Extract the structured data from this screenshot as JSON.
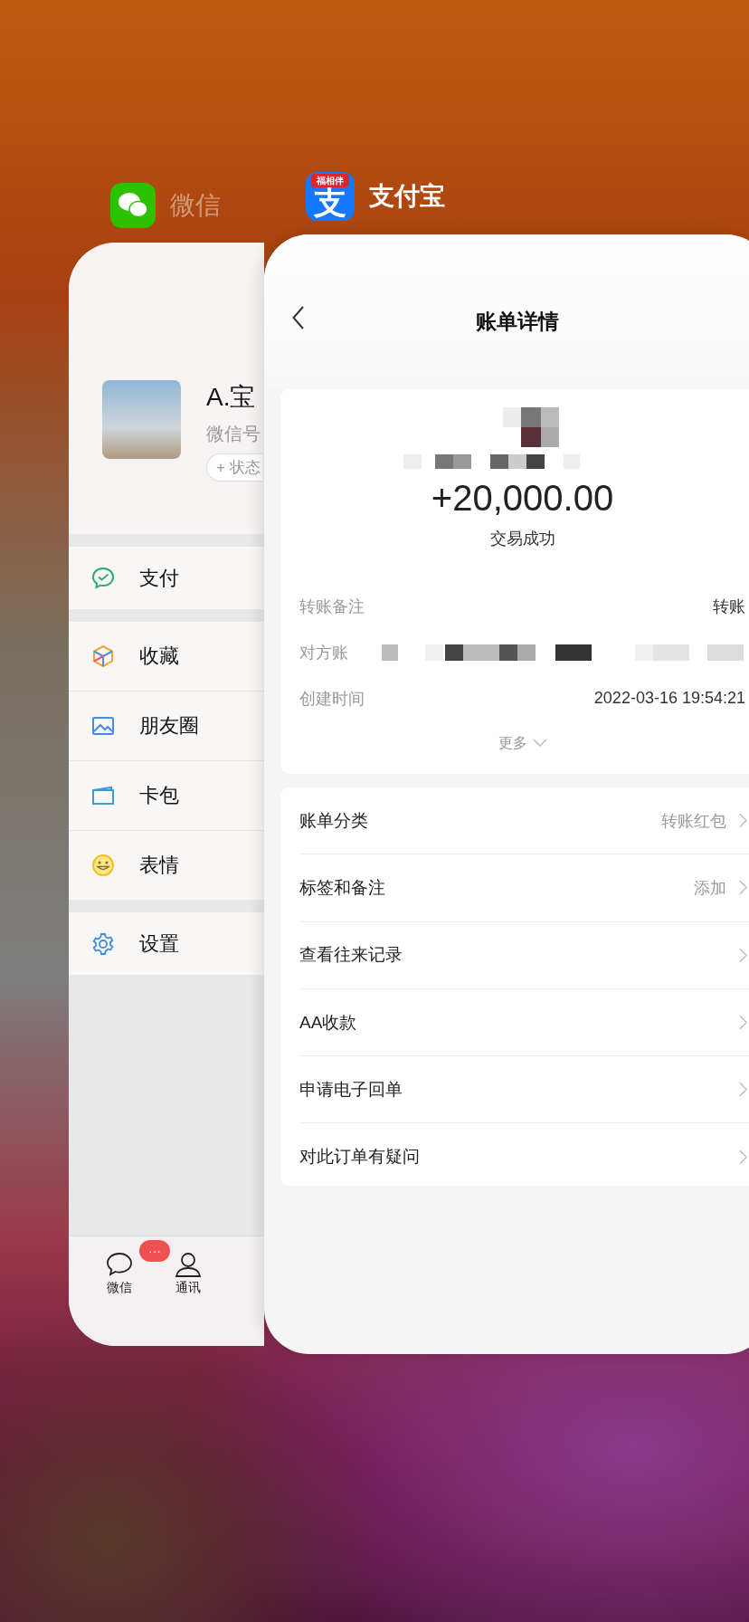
{
  "app_labels": [
    {
      "name": "微信"
    },
    {
      "name": "支付宝",
      "icon_text": "支",
      "icon_banner": "福相伴"
    }
  ],
  "wechat": {
    "profile": {
      "name": "A.宝",
      "id_label": "微信号",
      "status_button": "+ 状态"
    },
    "menu_groups": [
      [
        {
          "label": "支付"
        }
      ],
      [
        {
          "label": "收藏"
        },
        {
          "label": "朋友圈"
        },
        {
          "label": "卡包"
        },
        {
          "label": "表情"
        }
      ],
      [
        {
          "label": "设置"
        }
      ]
    ],
    "tab_bar": [
      {
        "label": "微信",
        "badge": "···"
      },
      {
        "label": "通讯"
      }
    ]
  },
  "alipay": {
    "title": "账单详情",
    "amount": "+20,000.00",
    "status": "交易成功",
    "details": [
      {
        "label": "转账备注",
        "value": "转账"
      },
      {
        "label": "对方账"
      },
      {
        "label": "创建时间",
        "value": "2022-03-16 19:54:21"
      }
    ],
    "more": "更多",
    "actions": [
      {
        "label": "账单分类",
        "value": "转账红包"
      },
      {
        "label": "标签和备注",
        "value": "添加"
      },
      {
        "label": "查看往来记录"
      },
      {
        "label": "AA收款"
      },
      {
        "label": "申请电子回单"
      },
      {
        "label": "对此订单有疑问"
      }
    ]
  }
}
